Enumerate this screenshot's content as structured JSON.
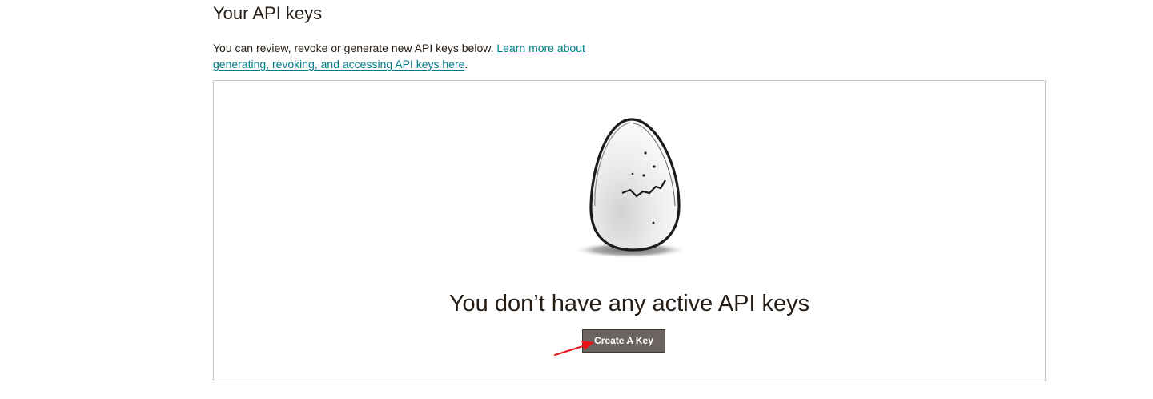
{
  "page": {
    "title": "Your API keys",
    "intro_text": "You can review, revoke or generate new API keys below. ",
    "intro_link": "Learn more about generating, revoking, and accessing API keys here",
    "intro_end": "."
  },
  "empty_state": {
    "illustration": "cracked-egg",
    "heading": "You don’t have any active API keys",
    "create_button": "Create A Key"
  },
  "colors": {
    "link": "#007c89",
    "button": "#6c6460",
    "annotation_arrow": "#e8151b"
  }
}
